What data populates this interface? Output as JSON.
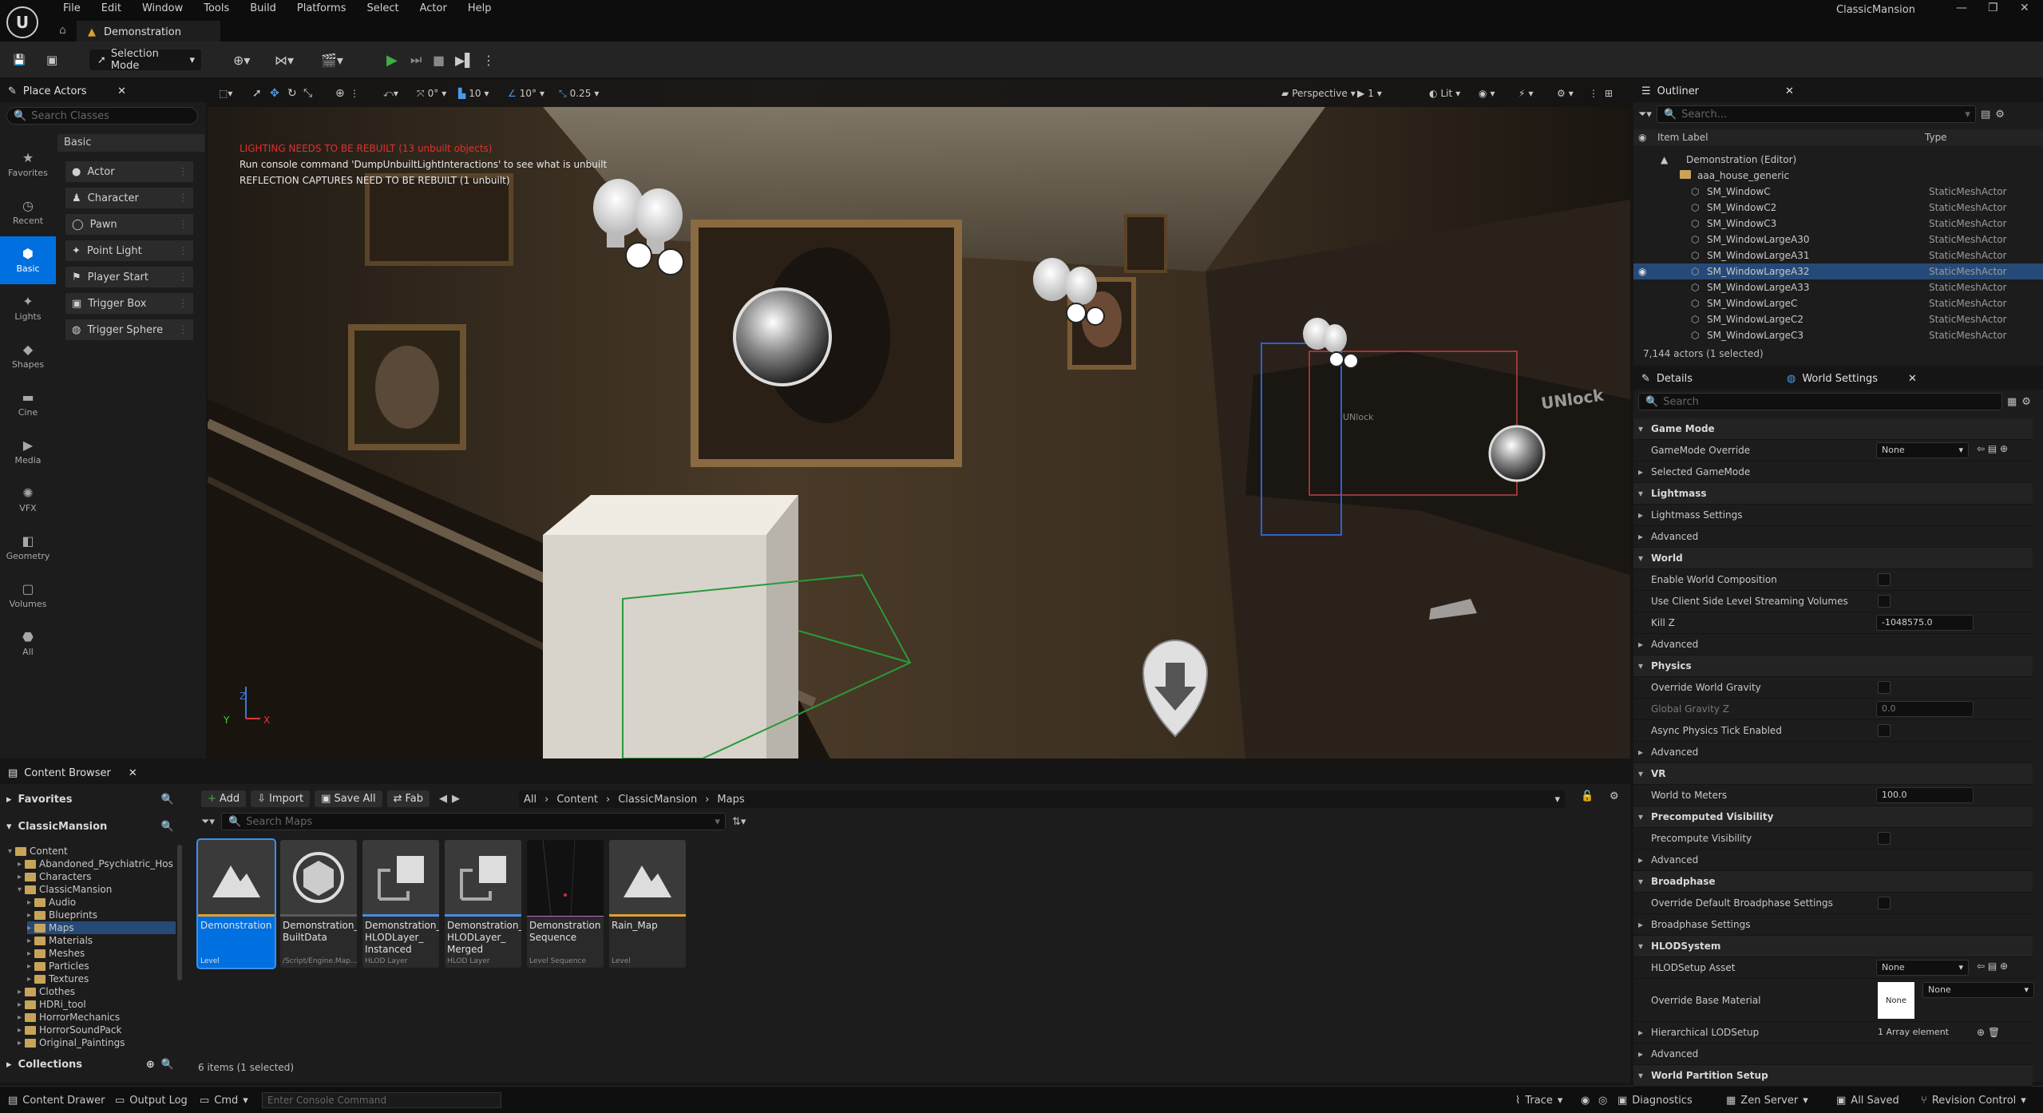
{
  "window": {
    "app_title": "ClassicMansion",
    "level_tab": "Demonstration"
  },
  "menu": [
    "File",
    "Edit",
    "Window",
    "Tools",
    "Build",
    "Platforms",
    "Select",
    "Actor",
    "Help"
  ],
  "toolbar": {
    "selection_mode": "Selection Mode"
  },
  "place_actors": {
    "title": "Place Actors",
    "search_placeholder": "Search Classes",
    "categories": [
      "Favorites",
      "Recent",
      "Basic",
      "Lights",
      "Shapes",
      "Cine",
      "Media",
      "VFX",
      "Geometry",
      "Volumes",
      "All"
    ],
    "section": "Basic",
    "items": [
      "Actor",
      "Character",
      "Pawn",
      "Point Light",
      "Player Start",
      "Trigger Box",
      "Trigger Sphere"
    ]
  },
  "viewport": {
    "move_snap": "0°",
    "rot_snap": "10",
    "angle_snap": "10°",
    "scale_snap": "0.25",
    "view_mode": "Perspective",
    "camera_speed": "1",
    "lighting": "Lit",
    "warn1": "LIGHTING NEEDS TO BE REBUILT (13 unbuilt objects)",
    "warn2": "Run console command 'DumpUnbuiltLightInteractions' to see what is unbuilt",
    "warn3": "REFLECTION CAPTURES NEED TO BE REBUILT (1 unbuilt)",
    "sign": "UNlock",
    "sign2": "UNlock",
    "accent_warn": "#e03030"
  },
  "outliner": {
    "title": "Outliner",
    "search_placeholder": "Search...",
    "col_label": "Item Label",
    "col_type": "Type",
    "root": "Demonstration (Editor)",
    "folder": "aaa_house_generic",
    "rows": [
      {
        "label": "SM_WindowC",
        "type": "StaticMeshActor"
      },
      {
        "label": "SM_WindowC2",
        "type": "StaticMeshActor"
      },
      {
        "label": "SM_WindowC3",
        "type": "StaticMeshActor"
      },
      {
        "label": "SM_WindowLargeA30",
        "type": "StaticMeshActor"
      },
      {
        "label": "SM_WindowLargeA31",
        "type": "StaticMeshActor"
      },
      {
        "label": "SM_WindowLargeA32",
        "type": "StaticMeshActor"
      },
      {
        "label": "SM_WindowLargeA33",
        "type": "StaticMeshActor"
      },
      {
        "label": "SM_WindowLargeC",
        "type": "StaticMeshActor"
      },
      {
        "label": "SM_WindowLargeC2",
        "type": "StaticMeshActor"
      },
      {
        "label": "SM_WindowLargeC3",
        "type": "StaticMeshActor"
      }
    ],
    "footer": "7,144 actors (1 selected)"
  },
  "details": {
    "tab1": "Details",
    "tab2": "World Settings",
    "search_placeholder": "Search",
    "rows": [
      {
        "k": "sec",
        "t": "Game Mode"
      },
      {
        "k": "field",
        "t": "GameMode Override",
        "v": "None",
        "w": "select"
      },
      {
        "k": "sub",
        "t": "Selected GameMode"
      },
      {
        "k": "sec",
        "t": "Lightmass"
      },
      {
        "k": "sub",
        "t": "Lightmass Settings"
      },
      {
        "k": "sub",
        "t": "Advanced"
      },
      {
        "k": "sec",
        "t": "World"
      },
      {
        "k": "field",
        "t": "Enable World Composition",
        "w": "check"
      },
      {
        "k": "field",
        "t": "Use Client Side Level Streaming Volumes",
        "w": "check"
      },
      {
        "k": "field",
        "t": "Kill Z",
        "v": "-1048575.0",
        "w": "input"
      },
      {
        "k": "sub",
        "t": "Advanced"
      },
      {
        "k": "sec",
        "t": "Physics"
      },
      {
        "k": "field",
        "t": "Override World Gravity",
        "w": "check"
      },
      {
        "k": "field",
        "t": "Global Gravity Z",
        "v": "0.0",
        "w": "input",
        "dim": true
      },
      {
        "k": "field",
        "t": "Async Physics Tick Enabled",
        "w": "check"
      },
      {
        "k": "sub",
        "t": "Advanced"
      },
      {
        "k": "sec",
        "t": "VR"
      },
      {
        "k": "field",
        "t": "World to Meters",
        "v": "100.0",
        "w": "input"
      },
      {
        "k": "sec",
        "t": "Precomputed Visibility"
      },
      {
        "k": "field",
        "t": "Precompute Visibility",
        "w": "check"
      },
      {
        "k": "sub",
        "t": "Advanced"
      },
      {
        "k": "sec",
        "t": "Broadphase"
      },
      {
        "k": "field",
        "t": "Override Default Broadphase Settings",
        "w": "check"
      },
      {
        "k": "sub",
        "t": "Broadphase Settings"
      },
      {
        "k": "sec",
        "t": "HLODSystem"
      },
      {
        "k": "field",
        "t": "HLODSetup Asset",
        "v": "None",
        "w": "select"
      },
      {
        "k": "field2",
        "t": "Override Base Material",
        "v": "None",
        "v2": "None"
      },
      {
        "k": "sub",
        "t": "Hierarchical LODSetup",
        "v": "1 Array element"
      },
      {
        "k": "sub",
        "t": "Advanced"
      },
      {
        "k": "sec",
        "t": "World Partition Setup"
      }
    ]
  },
  "content_browser": {
    "title": "Content Browser",
    "add": "Add",
    "import": "Import",
    "save_all": "Save All",
    "fab": "Fab",
    "path": [
      "All",
      "Content",
      "ClassicMansion",
      "Maps"
    ],
    "search_placeholder": "Search Maps",
    "favorites": "Favorites",
    "project": "ClassicMansion",
    "collections": "Collections",
    "tree": [
      {
        "n": "Content",
        "d": 0
      },
      {
        "n": "Abandoned_Psychiatric_Hos",
        "d": 1
      },
      {
        "n": "Characters",
        "d": 1
      },
      {
        "n": "ClassicMansion",
        "d": 1
      },
      {
        "n": "Audio",
        "d": 2
      },
      {
        "n": "Blueprints",
        "d": 2
      },
      {
        "n": "Maps",
        "d": 2,
        "sel": true
      },
      {
        "n": "Materials",
        "d": 2
      },
      {
        "n": "Meshes",
        "d": 2
      },
      {
        "n": "Particles",
        "d": 2
      },
      {
        "n": "Textures",
        "d": 2
      },
      {
        "n": "Clothes",
        "d": 1
      },
      {
        "n": "HDRi_tool",
        "d": 1
      },
      {
        "n": "HorrorMechanics",
        "d": 1
      },
      {
        "n": "HorrorSoundPack",
        "d": 1
      },
      {
        "n": "Original_Paintings",
        "d": 1
      }
    ],
    "assets": [
      {
        "name": "Demonstration",
        "sub": "Level",
        "sel": true
      },
      {
        "name": "Demonstration_\nBuiltData",
        "sub": "/Script/Engine.Map..."
      },
      {
        "name": "Demonstration_\nHLODLayer_\nInstanced",
        "sub": "HLOD Layer"
      },
      {
        "name": "Demonstration_\nHLODLayer_\nMerged",
        "sub": "HLOD Layer"
      },
      {
        "name": "Demonstration\nSequence",
        "sub": "Level Sequence"
      },
      {
        "name": "Rain_Map",
        "sub": "Level"
      }
    ],
    "count": "6 items (1 selected)"
  },
  "status": {
    "drawer": "Content Drawer",
    "output": "Output Log",
    "cmd": "Cmd",
    "console_placeholder": "Enter Console Command",
    "trace": "Trace",
    "diag": "Diagnostics",
    "zen": "Zen Server",
    "saved": "All Saved",
    "rc": "Revision Control"
  },
  "colors": {
    "accent": "#0070e0",
    "selection": "#264a78",
    "play": "#3cb043"
  }
}
